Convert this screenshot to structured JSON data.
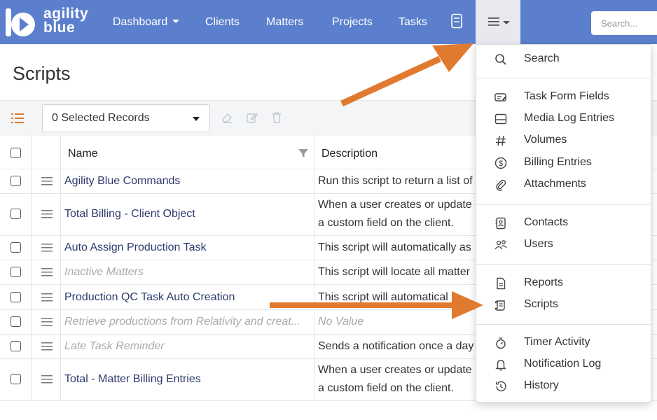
{
  "brand": {
    "line1": "agility",
    "line2": "blue"
  },
  "nav": {
    "items": [
      {
        "label": "Dashboard",
        "has_caret": true
      },
      {
        "label": "Clients"
      },
      {
        "label": "Matters"
      },
      {
        "label": "Projects"
      },
      {
        "label": "Tasks"
      }
    ],
    "search_placeholder": "Search..."
  },
  "page": {
    "title": "Scripts"
  },
  "toolbar": {
    "selected_records": "0 Selected Records"
  },
  "table": {
    "headers": {
      "name": "Name",
      "description": "Description"
    },
    "rows": [
      {
        "name": "Agility Blue Commands",
        "description": [
          "Run this script to return a list of"
        ],
        "inactive": false
      },
      {
        "name": "Total Billing - Client Object",
        "description": [
          "When a user creates or update",
          "a custom field on the client."
        ],
        "inactive": false
      },
      {
        "name": "Auto Assign Production Task",
        "description": [
          "This script will automatically as"
        ],
        "inactive": false
      },
      {
        "name": "Inactive Matters",
        "description": [
          "This script will locate all matter"
        ],
        "inactive": true
      },
      {
        "name": "Production QC Task Auto Creation",
        "description": [
          "This script will automatical"
        ],
        "inactive": false
      },
      {
        "name": "Retrieve productions from Relativity and creat...",
        "description": [
          "No Value"
        ],
        "inactive": true,
        "desc_inactive": true
      },
      {
        "name": "Late Task Reminder",
        "description": [
          "Sends a notification once a day"
        ],
        "inactive": true
      },
      {
        "name": "Total - Matter Billing Entries",
        "description": [
          "When a user creates or update",
          "a custom field on the client."
        ],
        "inactive": false
      }
    ]
  },
  "dropdown": {
    "groups": [
      [
        {
          "label": "Search",
          "icon": "search-icon"
        }
      ],
      [
        {
          "label": "Task Form Fields",
          "icon": "form-fields-icon"
        },
        {
          "label": "Media Log Entries",
          "icon": "media-log-icon"
        },
        {
          "label": "Volumes",
          "icon": "hash-icon"
        },
        {
          "label": "Billing Entries",
          "icon": "dollar-circle-icon"
        },
        {
          "label": "Attachments",
          "icon": "paperclip-icon"
        }
      ],
      [
        {
          "label": "Contacts",
          "icon": "contact-card-icon"
        },
        {
          "label": "Users",
          "icon": "users-icon"
        }
      ],
      [
        {
          "label": "Reports",
          "icon": "report-icon"
        },
        {
          "label": "Scripts",
          "icon": "script-icon"
        }
      ],
      [
        {
          "label": "Timer Activity",
          "icon": "stopwatch-icon"
        },
        {
          "label": "Notification Log",
          "icon": "bell-icon"
        },
        {
          "label": "History",
          "icon": "history-icon"
        }
      ]
    ]
  },
  "colors": {
    "navbar": "#5b7fcc",
    "arrow": "#e07a2e",
    "link": "#2e3a6e"
  }
}
